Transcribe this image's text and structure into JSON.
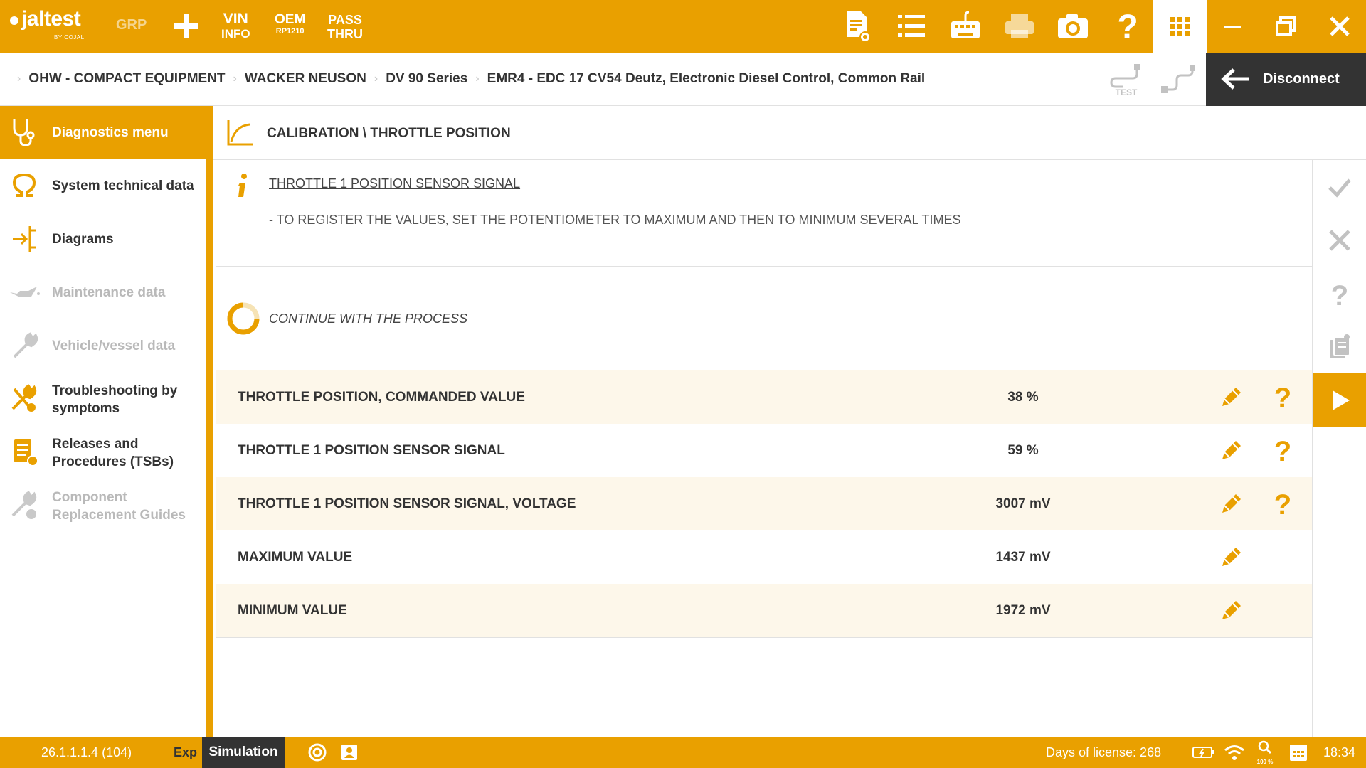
{
  "app": {
    "logo_text": "jaltest",
    "logo_sub": "BY COJALI",
    "accent_color": "#e9a000",
    "dark_color": "#333333"
  },
  "toolbar": {
    "grp_label": "GRP",
    "vin_label": "VIN",
    "vin_sub": "INFO",
    "oem_label": "OEM",
    "oem_sub": "RP1210",
    "pass_label": "PASS",
    "pass_sub": "THRU",
    "icons": [
      "plus-icon",
      "document-view-icon",
      "list-icon",
      "keyboard-icon",
      "printer-icon",
      "camera-icon",
      "help-icon",
      "apps-grid-icon",
      "minimize-icon",
      "restore-icon",
      "close-icon"
    ]
  },
  "breadcrumb": {
    "items": [
      "OHW - COMPACT EQUIPMENT",
      "WACKER NEUSON",
      "DV 90 Series",
      "EMR4 - EDC 17 CV54 Deutz, Electronic Diesel Control, Common Rail"
    ],
    "test_label": "TEST",
    "disconnect_label": "Disconnect"
  },
  "sidebar": {
    "items": [
      {
        "label": "Diagnostics menu",
        "icon": "stethoscope-icon",
        "state": "active"
      },
      {
        "label": "System technical data",
        "icon": "omega-icon",
        "state": "normal"
      },
      {
        "label": "Diagrams",
        "icon": "diagram-icon",
        "state": "normal"
      },
      {
        "label": "Maintenance data",
        "icon": "oil-can-icon",
        "state": "disabled"
      },
      {
        "label": "Vehicle/vessel data",
        "icon": "wrench-icon",
        "state": "disabled"
      },
      {
        "label": "Troubleshooting by symptoms",
        "icon": "tools-icon",
        "state": "normal"
      },
      {
        "label": "Releases and Procedures (TSBs)",
        "icon": "bulletin-icon",
        "state": "normal"
      },
      {
        "label": "Component Replacement Guides",
        "icon": "replace-tools-icon",
        "state": "disabled"
      }
    ]
  },
  "main": {
    "title": "CALIBRATION \\ THROTTLE POSITION",
    "info_title": "THROTTLE 1 POSITION SENSOR SIGNAL",
    "info_text": "- TO REGISTER THE VALUES, SET THE POTENTIOMETER TO MAXIMUM AND THEN TO MINIMUM SEVERAL TIMES",
    "process_label": "CONTINUE WITH THE PROCESS",
    "params": [
      {
        "name": "THROTTLE POSITION, COMMANDED VALUE",
        "value": "38 %",
        "has_help": true
      },
      {
        "name": "THROTTLE 1 POSITION SENSOR SIGNAL",
        "value": "59 %",
        "has_help": true
      },
      {
        "name": "THROTTLE 1 POSITION SENSOR SIGNAL, VOLTAGE",
        "value": "3007 mV",
        "has_help": true
      },
      {
        "name": "MAXIMUM VALUE",
        "value": "1437 mV",
        "has_help": false
      },
      {
        "name": "MINIMUM VALUE",
        "value": "1972 mV",
        "has_help": false
      }
    ]
  },
  "rail": {
    "buttons": [
      "check-icon",
      "cancel-icon",
      "question-icon",
      "clipboard-icon",
      "play-icon"
    ]
  },
  "statusbar": {
    "version": "26.1.1.1.4 (104)",
    "exp_label": "Exp",
    "simulation_label": "Simulation",
    "license_text": "Days of license: 268",
    "battery_label": "",
    "zoom_label": "100 %",
    "time": "18:34"
  }
}
